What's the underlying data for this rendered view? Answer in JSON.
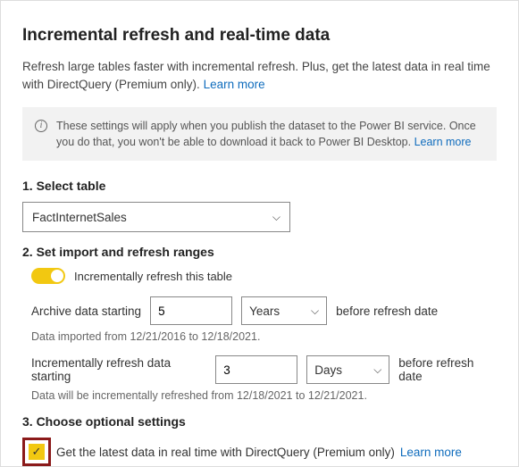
{
  "title": "Incremental refresh and real-time data",
  "description": "Refresh large tables faster with incremental refresh. Plus, get the latest data in real time with DirectQuery (Premium only).",
  "learn_more": "Learn more",
  "info_banner": "These settings will apply when you publish the dataset to the Power BI service. Once you do that, you won't be able to download it back to Power BI Desktop.",
  "section1": {
    "label": "1. Select table",
    "selected_table": "FactInternetSales"
  },
  "section2": {
    "label": "2. Set import and refresh ranges",
    "toggle_label": "Incrementally refresh this table",
    "archive_prefix": "Archive data starting",
    "archive_value": "5",
    "archive_unit": "Years",
    "suffix": "before refresh date",
    "archive_hint": "Data imported from 12/21/2016 to 12/18/2021.",
    "refresh_prefix": "Incrementally refresh data starting",
    "refresh_value": "3",
    "refresh_unit": "Days",
    "refresh_hint": "Data will be incrementally refreshed from 12/18/2021 to 12/21/2021."
  },
  "section3": {
    "label": "3. Choose optional settings",
    "realtime_label": "Get the latest data in real time with DirectQuery (Premium only)"
  }
}
